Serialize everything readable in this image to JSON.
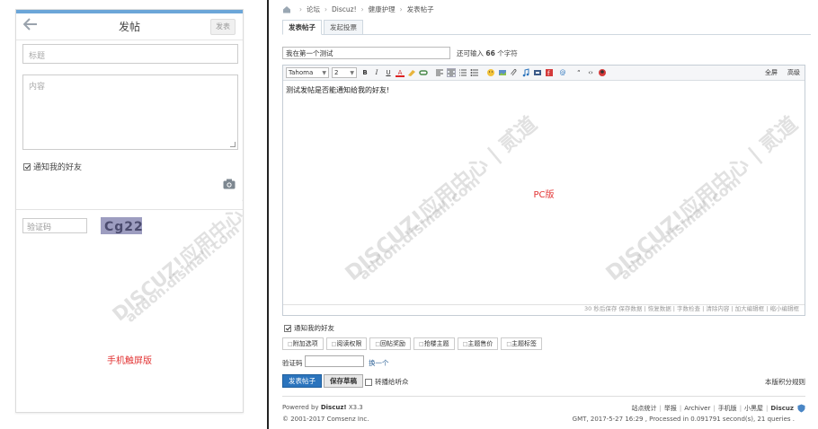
{
  "mobile": {
    "title": "发帖",
    "post_button": "发表",
    "title_placeholder": "标题",
    "content_placeholder": "内容",
    "notify_label": "通知我的好友",
    "captcha_placeholder": "验证码",
    "caption": "手机触屏版",
    "icons": {
      "back": "back-arrow-icon",
      "camera": "camera-icon"
    }
  },
  "pc": {
    "breadcrumb": [
      "论坛",
      "Discuz!",
      "健康护理",
      "发表帖子"
    ],
    "tabs": [
      "发表帖子",
      "发起投票"
    ],
    "title_value": "我在第一个测试",
    "remain_prefix": "还可输入",
    "remain_count": "66",
    "remain_suffix": "个字符",
    "toolbar": {
      "font": "Tahoma",
      "size": "2",
      "fullscreen": "全屏",
      "advanced": "高级"
    },
    "body_text": "测试发帖是否能通知给我的好友!",
    "caption": "PC版",
    "editor_status": "30 秒后保存 保存数据 | 恢复数据 | 字数检查 | 清除内容 | 加大编辑框 | 缩小编辑框",
    "notify_label": "通知我的好友",
    "options": [
      "附加选项",
      "阅读权限",
      "回帖奖励",
      "抢楼主题",
      "主题售价",
      "主题标签"
    ],
    "captcha_label": "验证码",
    "captcha_change": "换一个",
    "submit": "发表帖子",
    "draft": "保存草稿",
    "transfer_label": "转播给听众",
    "rules": "本版积分规则",
    "footer": {
      "powered_prefix": "Powered by",
      "powered_brand": "Discuz!",
      "powered_version": "X3.3",
      "copyright": "© 2001-2017 Comsenz Inc.",
      "links": [
        "站点统计",
        "举报",
        "Archiver",
        "手机版",
        "小黑屋",
        "Discuz"
      ],
      "gmt": "GMT, 2017-5-27 16:29 , Processed in 0.091791 second(s), 21 queries ."
    }
  },
  "colors": {
    "accent": "#2b74bd",
    "caption_red": "#e23232",
    "top_line": "#6ba6d8"
  }
}
